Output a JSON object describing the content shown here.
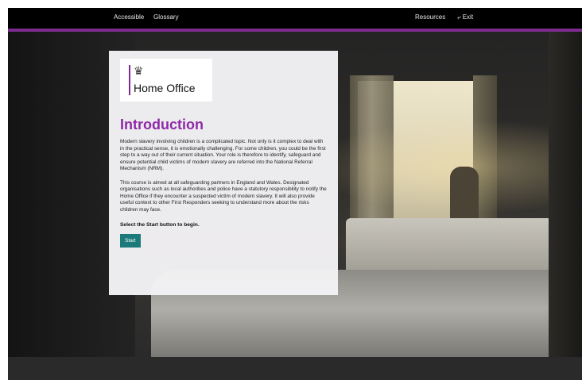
{
  "topbar": {
    "accessible_label": "Accessible",
    "glossary_label": "Glossary",
    "resources_label": "Resources",
    "exit_label": "Exit"
  },
  "logo": {
    "org_name": "Home Office",
    "crest_icon": "royal-crest-icon",
    "accent_color": "#7b2c8e"
  },
  "intro": {
    "title": "Introduction",
    "paragraph1": "Modern slavery involving children is a complicated topic. Not only is it complex to deal with in the practical sense, it is emotionally challenging. For some children, you could be the first step to a way out of their current situation. Your role is therefore to identify, safeguard and ensure potential child victims of modern slavery are referred into the National Referral Mechanism (NRM).",
    "paragraph2": "This course is aimed at all safeguarding partners in England and Wales. Designated organisations such as local authorities and police have a statutory responsibility to notify the Home Office if they encounter a suspected victim of modern slavery. It will also provide useful context to other First Responders seeking to understand more about the risks children may face.",
    "prompt_pre": "Select the ",
    "prompt_bold": "Start",
    "prompt_post": " button to begin.",
    "start_label": "Start"
  },
  "colors": {
    "title": "#8e2aa8",
    "start_button": "#1c7a7a",
    "topbar": "#000000"
  }
}
